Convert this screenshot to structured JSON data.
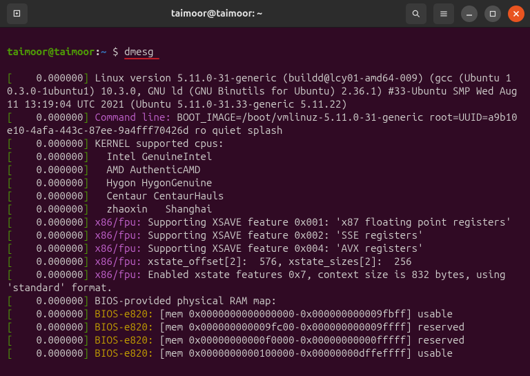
{
  "titlebar": {
    "title": "taimoor@taimoor: ~"
  },
  "prompt": {
    "userhost": "taimoor@taimoor",
    "sep": ":",
    "path": "~",
    "sigil": "$",
    "command": "dmesg"
  },
  "lines": [
    {
      "raw": "Linux version 5.11.0-31-generic (buildd@lcy01-amd64-009) (gcc (Ubuntu 10.3.0-1ubuntu1) 10.3.0, GNU ld (GNU Binutils for Ubuntu) 2.36.1) #33-Ubuntu SMP Wed Aug 11 13:19:04 UTC 2021 (Ubuntu 5.11.0-31.33-generic 5.11.22)"
    },
    {
      "tag": "Command line:",
      "rest": " BOOT_IMAGE=/boot/vmlinuz-5.11.0-31-generic root=UUID=a9b10e10-4afa-443c-87ee-9a4fff70426d ro quiet splash",
      "wrapped": true
    },
    {
      "raw": "KERNEL supported cpus:"
    },
    {
      "raw": "  Intel GenuineIntel"
    },
    {
      "raw": "  AMD AuthenticAMD"
    },
    {
      "raw": "  Hygon HygonGenuine"
    },
    {
      "raw": "  Centaur CentaurHauls"
    },
    {
      "raw": "  zhaoxin   Shanghai"
    },
    {
      "tag": "x86/fpu:",
      "rest": " Supporting XSAVE feature 0x001: 'x87 floating point registers'"
    },
    {
      "tag": "x86/fpu:",
      "rest": " Supporting XSAVE feature 0x002: 'SSE registers'"
    },
    {
      "tag": "x86/fpu:",
      "rest": " Supporting XSAVE feature 0x004: 'AVX registers'"
    },
    {
      "tag": "x86/fpu:",
      "rest": " xstate_offset[2]:  576, xstate_sizes[2]:  256"
    },
    {
      "tag": "x86/fpu:",
      "rest": " Enabled xstate features 0x7, context size is 832 bytes, using 'standard' format."
    },
    {
      "raw": "BIOS-provided physical RAM map:"
    },
    {
      "bios": true,
      "rest": " [mem 0x0000000000000000-0x000000000009fbff] usable"
    },
    {
      "bios": true,
      "rest": " [mem 0x000000000009fc00-0x000000000009ffff] reserved"
    },
    {
      "bios": true,
      "rest": " [mem 0x00000000000f0000-0x00000000000fffff] reserved"
    },
    {
      "bios": true,
      "rest": " [mem 0x0000000000100000-0x00000000dffeffff] usable"
    }
  ],
  "ts": "0.000000",
  "biosTag": "BIOS-e820:"
}
